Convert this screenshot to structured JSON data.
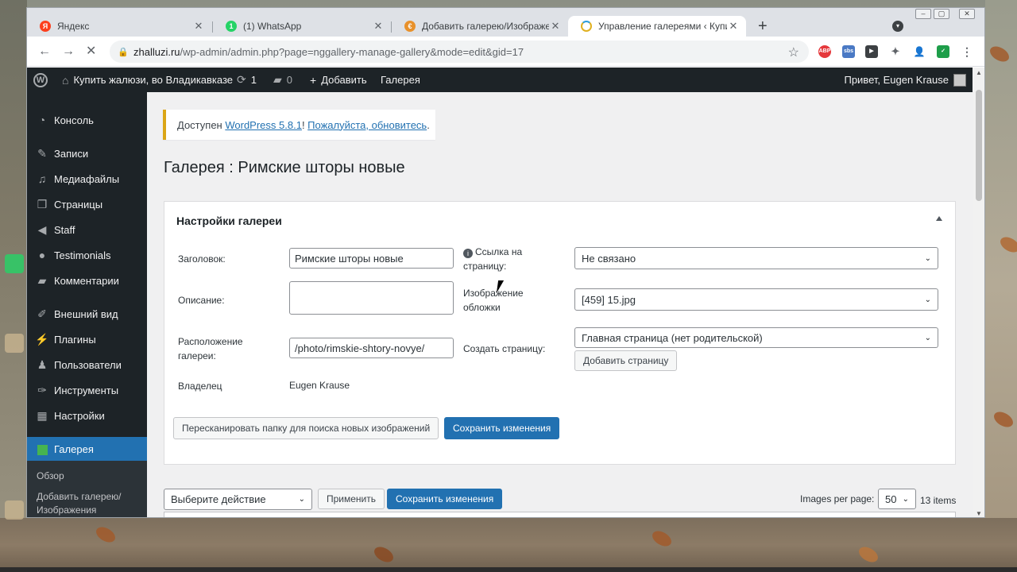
{
  "browser": {
    "tabs": [
      {
        "title": "Яндекс",
        "color": "#fc3f1d",
        "glyph": "Я"
      },
      {
        "title": "(1) WhatsApp",
        "color": "#25d366",
        "glyph": "1"
      },
      {
        "title": "Добавить галерею/Изображени…",
        "color": "#e8912b",
        "glyph": "€"
      },
      {
        "title": "Управление галереями ‹ Купить",
        "color": "#e0b020",
        "glyph": ""
      }
    ],
    "new_tab": "+",
    "url_main": "zhalluzi.ru",
    "url_path": "/wp-admin/admin.php?page=nggallery-manage-gallery&mode=edit&gid=17",
    "window_controls": [
      "‒",
      "▢",
      "✕"
    ],
    "extensions": [
      "ABP",
      "sbs",
      "▶",
      "✦",
      "👤",
      "✓",
      "⋮"
    ]
  },
  "adminbar": {
    "site": "Купить жалюзи, во Владикавказе",
    "updates": "1",
    "comments": "0",
    "add": "Добавить",
    "gallery": "Галерея",
    "greeting": "Привет, Eugen Krause"
  },
  "sidebar": {
    "items": [
      {
        "label": "Консоль",
        "icon": "dashboard-icon"
      },
      {
        "label": "Записи",
        "icon": "pin-icon"
      },
      {
        "label": "Медиафайлы",
        "icon": "media-icon"
      },
      {
        "label": "Страницы",
        "icon": "pages-icon"
      },
      {
        "label": "Staff",
        "icon": "megaphone-icon"
      },
      {
        "label": "Testimonials",
        "icon": "testimonials-icon"
      },
      {
        "label": "Комментарии",
        "icon": "comments-icon"
      },
      {
        "label": "Внешний вид",
        "icon": "brush-icon"
      },
      {
        "label": "Плагины",
        "icon": "plugin-icon"
      },
      {
        "label": "Пользователи",
        "icon": "users-icon"
      },
      {
        "label": "Инструменты",
        "icon": "wrench-icon"
      },
      {
        "label": "Настройки",
        "icon": "settings-icon"
      },
      {
        "label": "Галерея",
        "icon": "gallery-icon"
      }
    ],
    "sub": [
      "Обзор",
      "Добавить галерею/ Изображения"
    ]
  },
  "notice": {
    "prefix": "Доступен ",
    "link1": "WordPress 5.8.1",
    "mid": "! ",
    "link2": "Пожалуйста, обновитесь",
    "suffix": "."
  },
  "page_title": "Галерея : Римские шторы новые",
  "settings": {
    "heading": "Настройки галереи",
    "title_label": "Заголовок:",
    "title_value": "Римские шторы новые",
    "desc_label": "Описание:",
    "path_label": "Расположение галереи:",
    "path_value": "/photo/rimskie-shtory-novye/",
    "owner_label": "Владелец",
    "owner_value": "Eugen Krause",
    "link_label": "Ссылка на страницу:",
    "link_value": "Не связано",
    "cover_label": "Изображение обложки",
    "cover_value": "[459] 15.jpg",
    "create_label": "Создать страницу:",
    "create_value": "Главная страница (нет родительской)",
    "add_page_btn": "Добавить страницу",
    "rescan_btn": "Пересканировать папку для поиска новых изображений",
    "save_btn": "Сохранить изменения"
  },
  "bulk": {
    "action": "Выберите действие",
    "apply": "Применить",
    "save": "Сохранить изменения",
    "per_page_label": "Images per page:",
    "per_page": "50",
    "count": "13 items"
  },
  "colors": {
    "wp_blue": "#2271b1",
    "admin_dark": "#1d2327",
    "gallery_green": "#46b450"
  }
}
